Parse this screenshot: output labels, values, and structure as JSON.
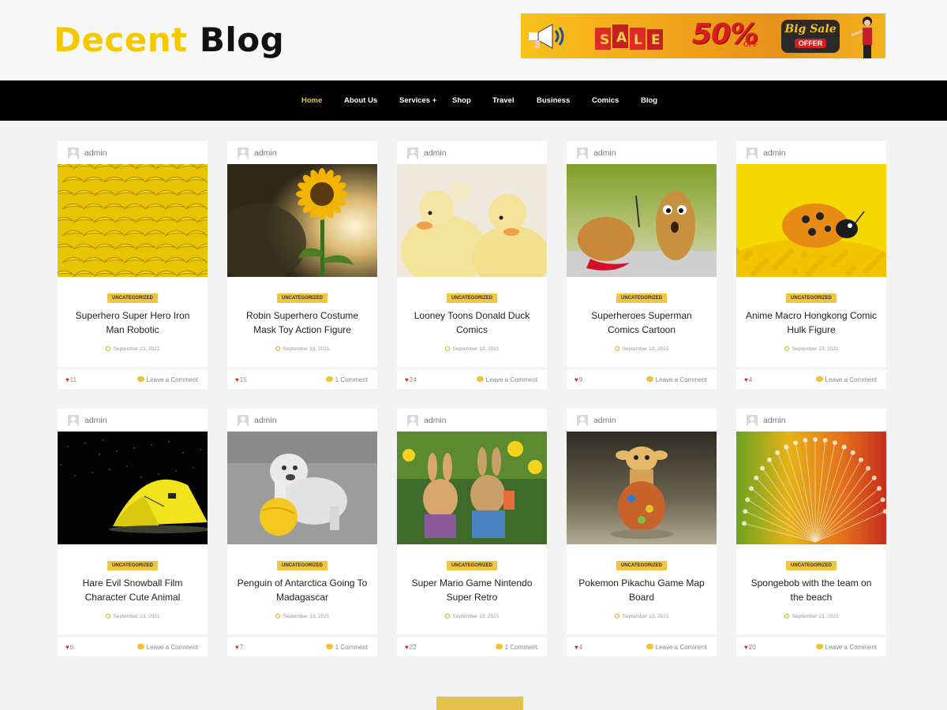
{
  "header": {
    "logo_part1": "Decent",
    "logo_part2": "Blog",
    "banner": {
      "sale_text": "SALE",
      "discount": "50%",
      "off_text": "OFF",
      "big_sale": "Big Sale",
      "offer": "OFFER"
    }
  },
  "nav": {
    "items": [
      {
        "label": "Home",
        "active": true
      },
      {
        "label": "About Us"
      },
      {
        "label": "Services +"
      },
      {
        "label": "Shop"
      },
      {
        "label": "Travel"
      },
      {
        "label": "Business"
      },
      {
        "label": "Comics"
      },
      {
        "label": "Blog"
      }
    ]
  },
  "colors": {
    "accent": "#f5c800",
    "nav_bg": "#000000",
    "nav_active": "#f5c32c",
    "category_bg": "#f0c53f"
  },
  "posts": [
    {
      "author": "admin",
      "category": "UNCATEGORIZED",
      "title": "Superhero Super Hero Iron Man Robotic",
      "date": "September 13, 2021",
      "views": "11",
      "comments": "Leave a Comment",
      "image": "bananas"
    },
    {
      "author": "admin",
      "category": "UNCATEGORIZED",
      "title": "Robin Superhero Costume Mask Toy Action Figure",
      "date": "September 13, 2021",
      "views": "15",
      "comments": "1 Comment",
      "image": "sunflower"
    },
    {
      "author": "admin",
      "category": "UNCATEGORIZED",
      "title": "Looney Toons Donald Duck Comics",
      "date": "September 13, 2021",
      "views": "24",
      "comments": "Leave a Comment",
      "image": "ducklings"
    },
    {
      "author": "admin",
      "category": "UNCATEGORIZED",
      "title": "Superheroes Superman Comics Cartoon",
      "date": "September 13, 2021",
      "views": "9",
      "comments": "Leave a Comment",
      "image": "potatoes"
    },
    {
      "author": "admin",
      "category": "UNCATEGORIZED",
      "title": "Anime Macro Hongkong Comic Hulk Figure",
      "date": "September 13, 2021",
      "views": "4",
      "comments": "Leave a Comment",
      "image": "ladybug"
    },
    {
      "author": "admin",
      "category": "UNCATEGORIZED",
      "title": "Hare Evil Snowball Film Character Cute Animal",
      "date": "September 13, 2021",
      "views": "6",
      "comments": "Leave a Comment",
      "image": "tent"
    },
    {
      "author": "admin",
      "category": "UNCATEGORIZED",
      "title": "Penguin of Antarctica Going To Madagascar",
      "date": "September 13, 2021",
      "views": "7",
      "comments": "1 Comment",
      "image": "bulldog"
    },
    {
      "author": "admin",
      "category": "UNCATEGORIZED",
      "title": "Super Mario Game Nintendo Super Retro",
      "date": "September 13, 2021",
      "views": "22",
      "comments": "1 Comment",
      "image": "rabbits"
    },
    {
      "author": "admin",
      "category": "UNCATEGORIZED",
      "title": "Pokemon Pikachu Game Map Board",
      "date": "September 13, 2021",
      "views": "4",
      "comments": "Leave a Comment",
      "image": "giraffe-toy"
    },
    {
      "author": "admin",
      "category": "UNCATEGORIZED",
      "title": "Spongebob with the team on the beach",
      "date": "September 13, 2021",
      "views": "20",
      "comments": "Leave a Comment",
      "image": "dandelion"
    }
  ]
}
